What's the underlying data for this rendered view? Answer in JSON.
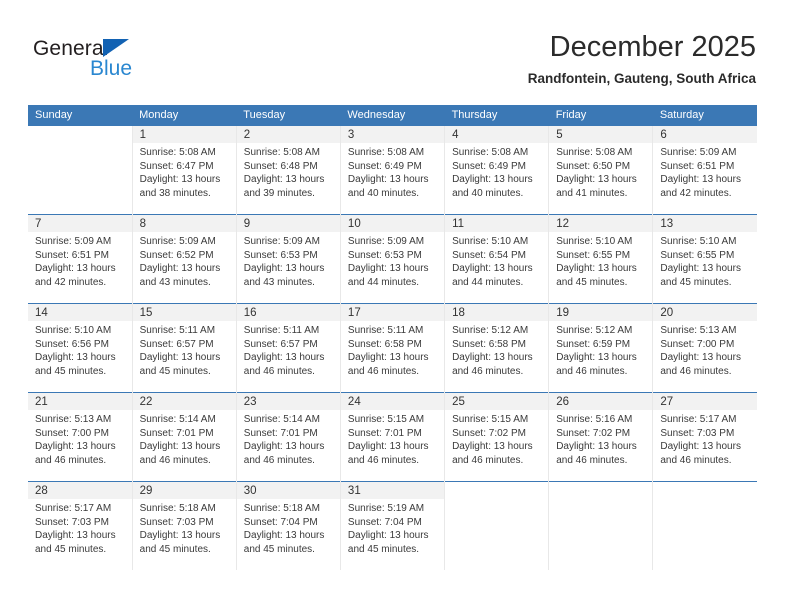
{
  "brand": {
    "name_top": "General",
    "name_bottom": "Blue",
    "triangle_icon": "triangle-icon",
    "color_dark": "#231f20",
    "color_blue": "#2a87d0",
    "triangle_color": "#1262b3"
  },
  "header": {
    "title": "December 2025",
    "subtitle": "Randfontein, Gauteng, South Africa"
  },
  "theme": {
    "header_blue": "#3b78b5",
    "daynum_band": "#f2f2f2",
    "text": "#3a3a3a"
  },
  "calendar": {
    "weekday_headers": [
      "Sunday",
      "Monday",
      "Tuesday",
      "Wednesday",
      "Thursday",
      "Friday",
      "Saturday"
    ],
    "weeks": [
      [
        {
          "day": "",
          "blank": true,
          "lines": []
        },
        {
          "day": "1",
          "lines": [
            "Sunrise: 5:08 AM",
            "Sunset: 6:47 PM",
            "Daylight: 13 hours",
            "and 38 minutes."
          ]
        },
        {
          "day": "2",
          "lines": [
            "Sunrise: 5:08 AM",
            "Sunset: 6:48 PM",
            "Daylight: 13 hours",
            "and 39 minutes."
          ]
        },
        {
          "day": "3",
          "lines": [
            "Sunrise: 5:08 AM",
            "Sunset: 6:49 PM",
            "Daylight: 13 hours",
            "and 40 minutes."
          ]
        },
        {
          "day": "4",
          "lines": [
            "Sunrise: 5:08 AM",
            "Sunset: 6:49 PM",
            "Daylight: 13 hours",
            "and 40 minutes."
          ]
        },
        {
          "day": "5",
          "lines": [
            "Sunrise: 5:08 AM",
            "Sunset: 6:50 PM",
            "Daylight: 13 hours",
            "and 41 minutes."
          ]
        },
        {
          "day": "6",
          "lines": [
            "Sunrise: 5:09 AM",
            "Sunset: 6:51 PM",
            "Daylight: 13 hours",
            "and 42 minutes."
          ]
        }
      ],
      [
        {
          "day": "7",
          "lines": [
            "Sunrise: 5:09 AM",
            "Sunset: 6:51 PM",
            "Daylight: 13 hours",
            "and 42 minutes."
          ]
        },
        {
          "day": "8",
          "lines": [
            "Sunrise: 5:09 AM",
            "Sunset: 6:52 PM",
            "Daylight: 13 hours",
            "and 43 minutes."
          ]
        },
        {
          "day": "9",
          "lines": [
            "Sunrise: 5:09 AM",
            "Sunset: 6:53 PM",
            "Daylight: 13 hours",
            "and 43 minutes."
          ]
        },
        {
          "day": "10",
          "lines": [
            "Sunrise: 5:09 AM",
            "Sunset: 6:53 PM",
            "Daylight: 13 hours",
            "and 44 minutes."
          ]
        },
        {
          "day": "11",
          "lines": [
            "Sunrise: 5:10 AM",
            "Sunset: 6:54 PM",
            "Daylight: 13 hours",
            "and 44 minutes."
          ]
        },
        {
          "day": "12",
          "lines": [
            "Sunrise: 5:10 AM",
            "Sunset: 6:55 PM",
            "Daylight: 13 hours",
            "and 45 minutes."
          ]
        },
        {
          "day": "13",
          "lines": [
            "Sunrise: 5:10 AM",
            "Sunset: 6:55 PM",
            "Daylight: 13 hours",
            "and 45 minutes."
          ]
        }
      ],
      [
        {
          "day": "14",
          "lines": [
            "Sunrise: 5:10 AM",
            "Sunset: 6:56 PM",
            "Daylight: 13 hours",
            "and 45 minutes."
          ]
        },
        {
          "day": "15",
          "lines": [
            "Sunrise: 5:11 AM",
            "Sunset: 6:57 PM",
            "Daylight: 13 hours",
            "and 45 minutes."
          ]
        },
        {
          "day": "16",
          "lines": [
            "Sunrise: 5:11 AM",
            "Sunset: 6:57 PM",
            "Daylight: 13 hours",
            "and 46 minutes."
          ]
        },
        {
          "day": "17",
          "lines": [
            "Sunrise: 5:11 AM",
            "Sunset: 6:58 PM",
            "Daylight: 13 hours",
            "and 46 minutes."
          ]
        },
        {
          "day": "18",
          "lines": [
            "Sunrise: 5:12 AM",
            "Sunset: 6:58 PM",
            "Daylight: 13 hours",
            "and 46 minutes."
          ]
        },
        {
          "day": "19",
          "lines": [
            "Sunrise: 5:12 AM",
            "Sunset: 6:59 PM",
            "Daylight: 13 hours",
            "and 46 minutes."
          ]
        },
        {
          "day": "20",
          "lines": [
            "Sunrise: 5:13 AM",
            "Sunset: 7:00 PM",
            "Daylight: 13 hours",
            "and 46 minutes."
          ]
        }
      ],
      [
        {
          "day": "21",
          "lines": [
            "Sunrise: 5:13 AM",
            "Sunset: 7:00 PM",
            "Daylight: 13 hours",
            "and 46 minutes."
          ]
        },
        {
          "day": "22",
          "lines": [
            "Sunrise: 5:14 AM",
            "Sunset: 7:01 PM",
            "Daylight: 13 hours",
            "and 46 minutes."
          ]
        },
        {
          "day": "23",
          "lines": [
            "Sunrise: 5:14 AM",
            "Sunset: 7:01 PM",
            "Daylight: 13 hours",
            "and 46 minutes."
          ]
        },
        {
          "day": "24",
          "lines": [
            "Sunrise: 5:15 AM",
            "Sunset: 7:01 PM",
            "Daylight: 13 hours",
            "and 46 minutes."
          ]
        },
        {
          "day": "25",
          "lines": [
            "Sunrise: 5:15 AM",
            "Sunset: 7:02 PM",
            "Daylight: 13 hours",
            "and 46 minutes."
          ]
        },
        {
          "day": "26",
          "lines": [
            "Sunrise: 5:16 AM",
            "Sunset: 7:02 PM",
            "Daylight: 13 hours",
            "and 46 minutes."
          ]
        },
        {
          "day": "27",
          "lines": [
            "Sunrise: 5:17 AM",
            "Sunset: 7:03 PM",
            "Daylight: 13 hours",
            "and 46 minutes."
          ]
        }
      ],
      [
        {
          "day": "28",
          "lines": [
            "Sunrise: 5:17 AM",
            "Sunset: 7:03 PM",
            "Daylight: 13 hours",
            "and 45 minutes."
          ]
        },
        {
          "day": "29",
          "lines": [
            "Sunrise: 5:18 AM",
            "Sunset: 7:03 PM",
            "Daylight: 13 hours",
            "and 45 minutes."
          ]
        },
        {
          "day": "30",
          "lines": [
            "Sunrise: 5:18 AM",
            "Sunset: 7:04 PM",
            "Daylight: 13 hours",
            "and 45 minutes."
          ]
        },
        {
          "day": "31",
          "lines": [
            "Sunrise: 5:19 AM",
            "Sunset: 7:04 PM",
            "Daylight: 13 hours",
            "and 45 minutes."
          ]
        },
        {
          "day": "",
          "blank": true,
          "lines": []
        },
        {
          "day": "",
          "blank": true,
          "lines": []
        },
        {
          "day": "",
          "blank": true,
          "lines": []
        }
      ]
    ]
  }
}
